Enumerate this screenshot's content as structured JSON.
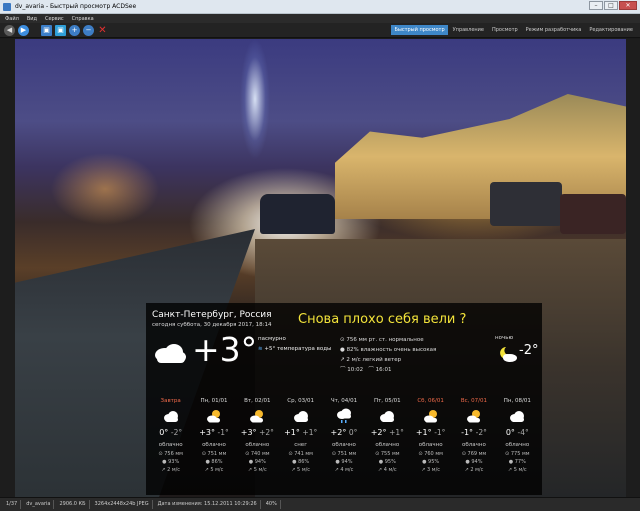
{
  "window": {
    "title": "dv_avaria - Быстрый просмотр ACDSee",
    "min": "–",
    "max": "□",
    "close": "✕"
  },
  "menu": [
    "Файл",
    "Вид",
    "Сервис",
    "Справка"
  ],
  "modes": [
    "Быстрый просмотр",
    "Управление",
    "Просмотр",
    "Режим разработчика",
    "Редактирование"
  ],
  "weather": {
    "city": "Санкт-Петербург, Россия",
    "date": "сегодня суббота, 30 декабря 2017, 18:14",
    "headline": "Снова плохо себя вели ?",
    "temp": "+3°",
    "condition": "пасмурно",
    "water": "+5° температура воды",
    "pressure": "756 мм рт. ст. нормальное",
    "humidity": "82% влажность очень высокая",
    "wind": "2 м/с легкий ветер",
    "sunrise": "10:02",
    "sunset": "16:01",
    "night_label": "ночью",
    "night_temp": "-2°",
    "days": [
      {
        "name": "Завтра",
        "red": true,
        "hi": "0°",
        "lo": "-2°",
        "cond": "облачно",
        "p": "756 мм",
        "h": "93%",
        "w": "2 м/с",
        "icon": "cloud"
      },
      {
        "name": "Пн, 01/01",
        "red": false,
        "hi": "+3°",
        "lo": "-1°",
        "cond": "облачно",
        "p": "751 мм",
        "h": "86%",
        "w": "5 м/с",
        "icon": "sun-cloud"
      },
      {
        "name": "Вт, 02/01",
        "red": false,
        "hi": "+3°",
        "lo": "+2°",
        "cond": "облачно",
        "p": "740 мм",
        "h": "94%",
        "w": "5 м/с",
        "icon": "sun-cloud"
      },
      {
        "name": "Ср, 03/01",
        "red": false,
        "hi": "+1°",
        "lo": "+1°",
        "cond": "снег",
        "p": "741 мм",
        "h": "86%",
        "w": "5 м/с",
        "icon": "cloud"
      },
      {
        "name": "Чт, 04/01",
        "red": false,
        "hi": "+2°",
        "lo": "0°",
        "cond": "облачно",
        "p": "751 мм",
        "h": "94%",
        "w": "4 м/с",
        "icon": "rain"
      },
      {
        "name": "Пт, 05/01",
        "red": false,
        "hi": "+2°",
        "lo": "+1°",
        "cond": "облачно",
        "p": "755 мм",
        "h": "95%",
        "w": "4 м/с",
        "icon": "cloud"
      },
      {
        "name": "Сб, 06/01",
        "red": true,
        "hi": "+1°",
        "lo": "-1°",
        "cond": "облачно",
        "p": "760 мм",
        "h": "95%",
        "w": "3 м/с",
        "icon": "sun-cloud"
      },
      {
        "name": "Вс, 07/01",
        "red": true,
        "hi": "-1°",
        "lo": "-2°",
        "cond": "облачно",
        "p": "769 мм",
        "h": "94%",
        "w": "2 м/с",
        "icon": "sun-cloud"
      },
      {
        "name": "Пн, 08/01",
        "red": false,
        "hi": "0°",
        "lo": "-4°",
        "cond": "облачно",
        "p": "775 мм",
        "h": "77%",
        "w": "5 м/с",
        "icon": "cloud"
      }
    ]
  },
  "status": [
    "1/37",
    "dv_avaria",
    "2906.0 КБ",
    "3264x2448x24b JPEG",
    "Дата изменения: 15.12.2011 10:29:26",
    "40%"
  ]
}
